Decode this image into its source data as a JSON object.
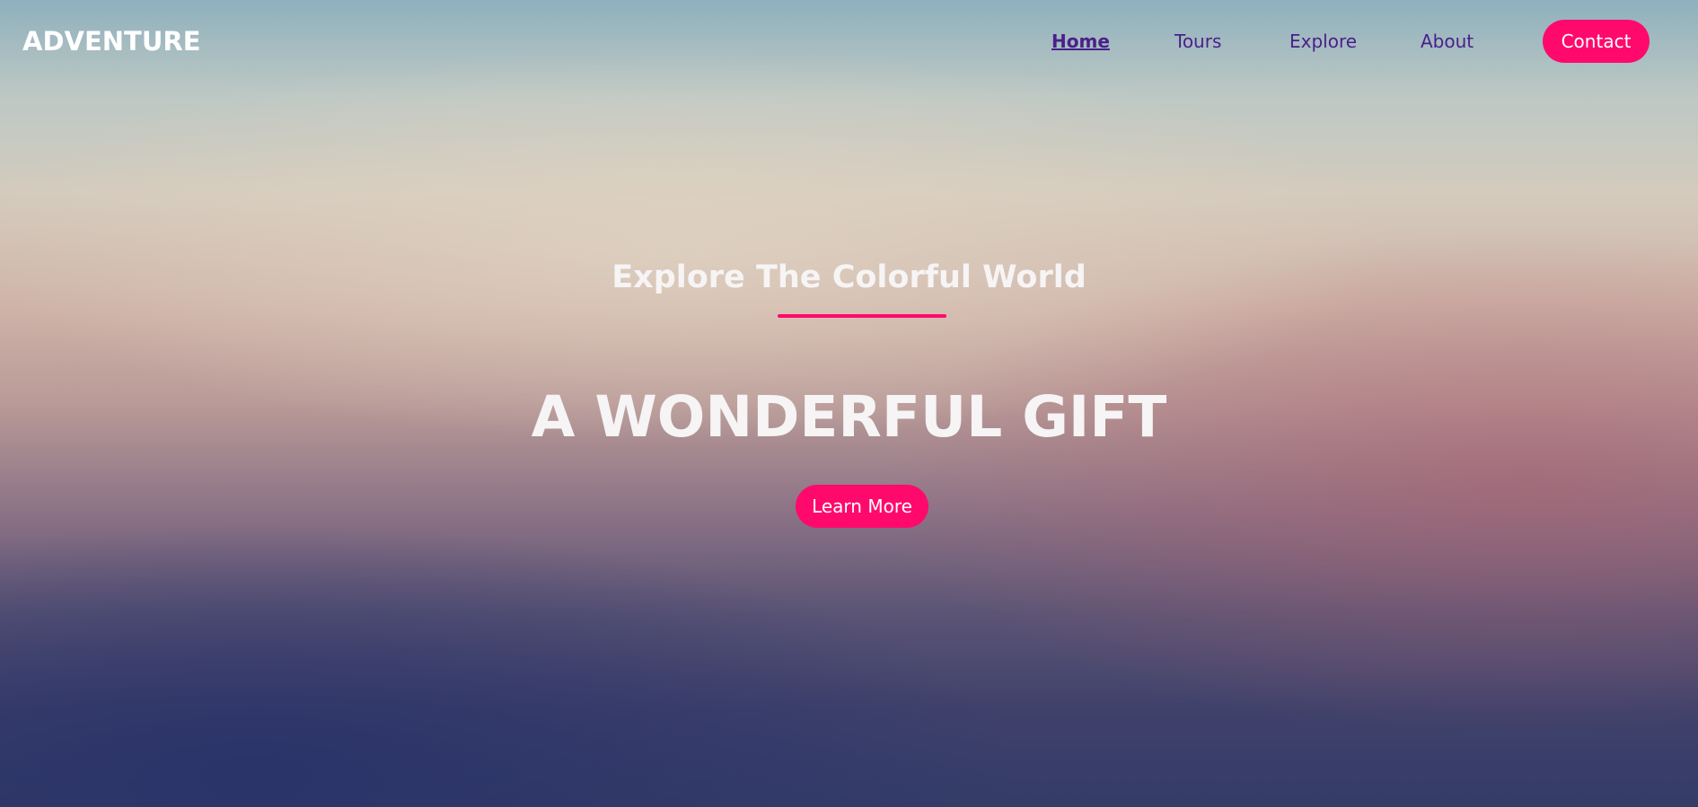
{
  "header": {
    "logo": "ADVENTURE",
    "nav": [
      {
        "label": "Home",
        "active": true
      },
      {
        "label": "Tours",
        "active": false
      },
      {
        "label": "Explore",
        "active": false
      },
      {
        "label": "About",
        "active": false
      }
    ],
    "contact_label": "Contact"
  },
  "hero": {
    "subtitle": "Explore The Colorful World",
    "title": "A WONDERFUL GIFT",
    "cta_label": "Learn More"
  },
  "colors": {
    "accent": "#ff0a6c",
    "nav_text": "#4a1f8a",
    "hero_text": "#f6f4f5"
  }
}
